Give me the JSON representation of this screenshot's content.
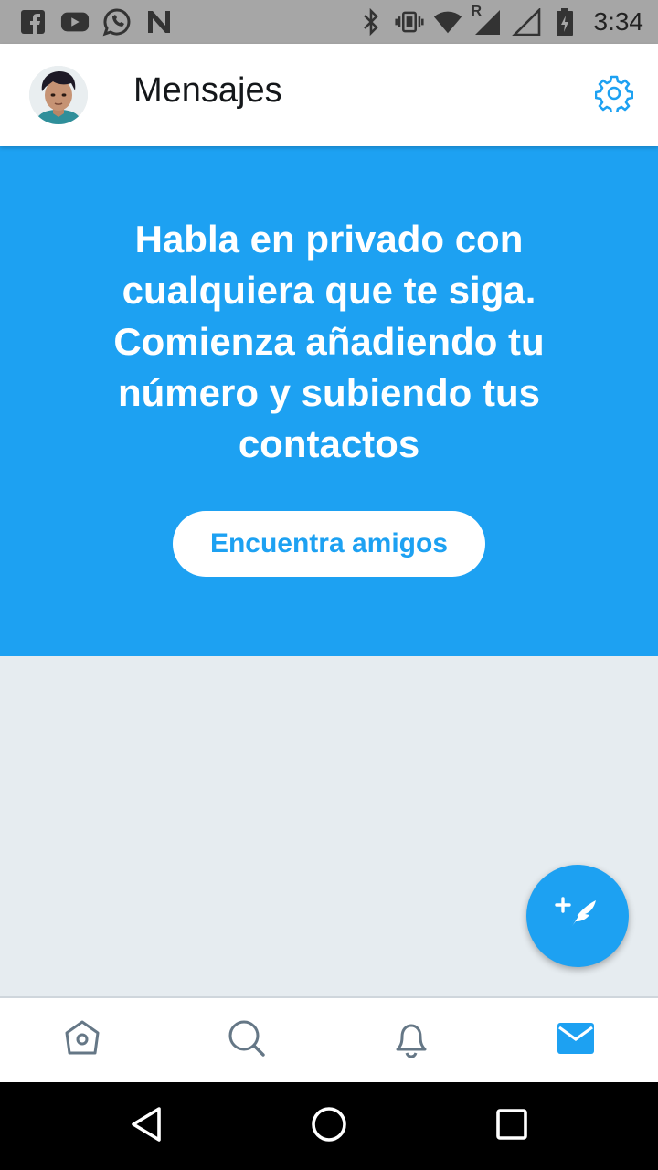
{
  "status_bar": {
    "time": "3:34",
    "left_icons": [
      "facebook-icon",
      "youtube-icon",
      "whatsapp-icon",
      "n-app-icon"
    ],
    "right_icons": [
      "bluetooth-icon",
      "vibrate-icon",
      "wifi-icon",
      "signal-roaming-icon",
      "signal-icon",
      "battery-icon"
    ],
    "roaming_label": "R"
  },
  "header": {
    "title": "Mensajes",
    "settings_icon": "gear-icon"
  },
  "promo": {
    "text": "Habla en privado con cualquiera que te siga. Comienza añadiendo tu número y subiendo tus contactos",
    "button_label": "Encuentra amigos"
  },
  "fab": {
    "icon": "compose-message-icon"
  },
  "bottom_nav": {
    "items": [
      {
        "icon": "home-icon"
      },
      {
        "icon": "search-icon"
      },
      {
        "icon": "bell-icon"
      },
      {
        "icon": "mail-icon",
        "active": true
      }
    ]
  },
  "system_nav": {
    "buttons": [
      "back-icon",
      "home-circle-icon",
      "recents-icon"
    ]
  },
  "colors": {
    "accent": "#1da1f2",
    "background": "#e6ecf0",
    "status_bar": "#a6a6a6",
    "title_text": "#14171a",
    "nav_icon": "#657786"
  }
}
